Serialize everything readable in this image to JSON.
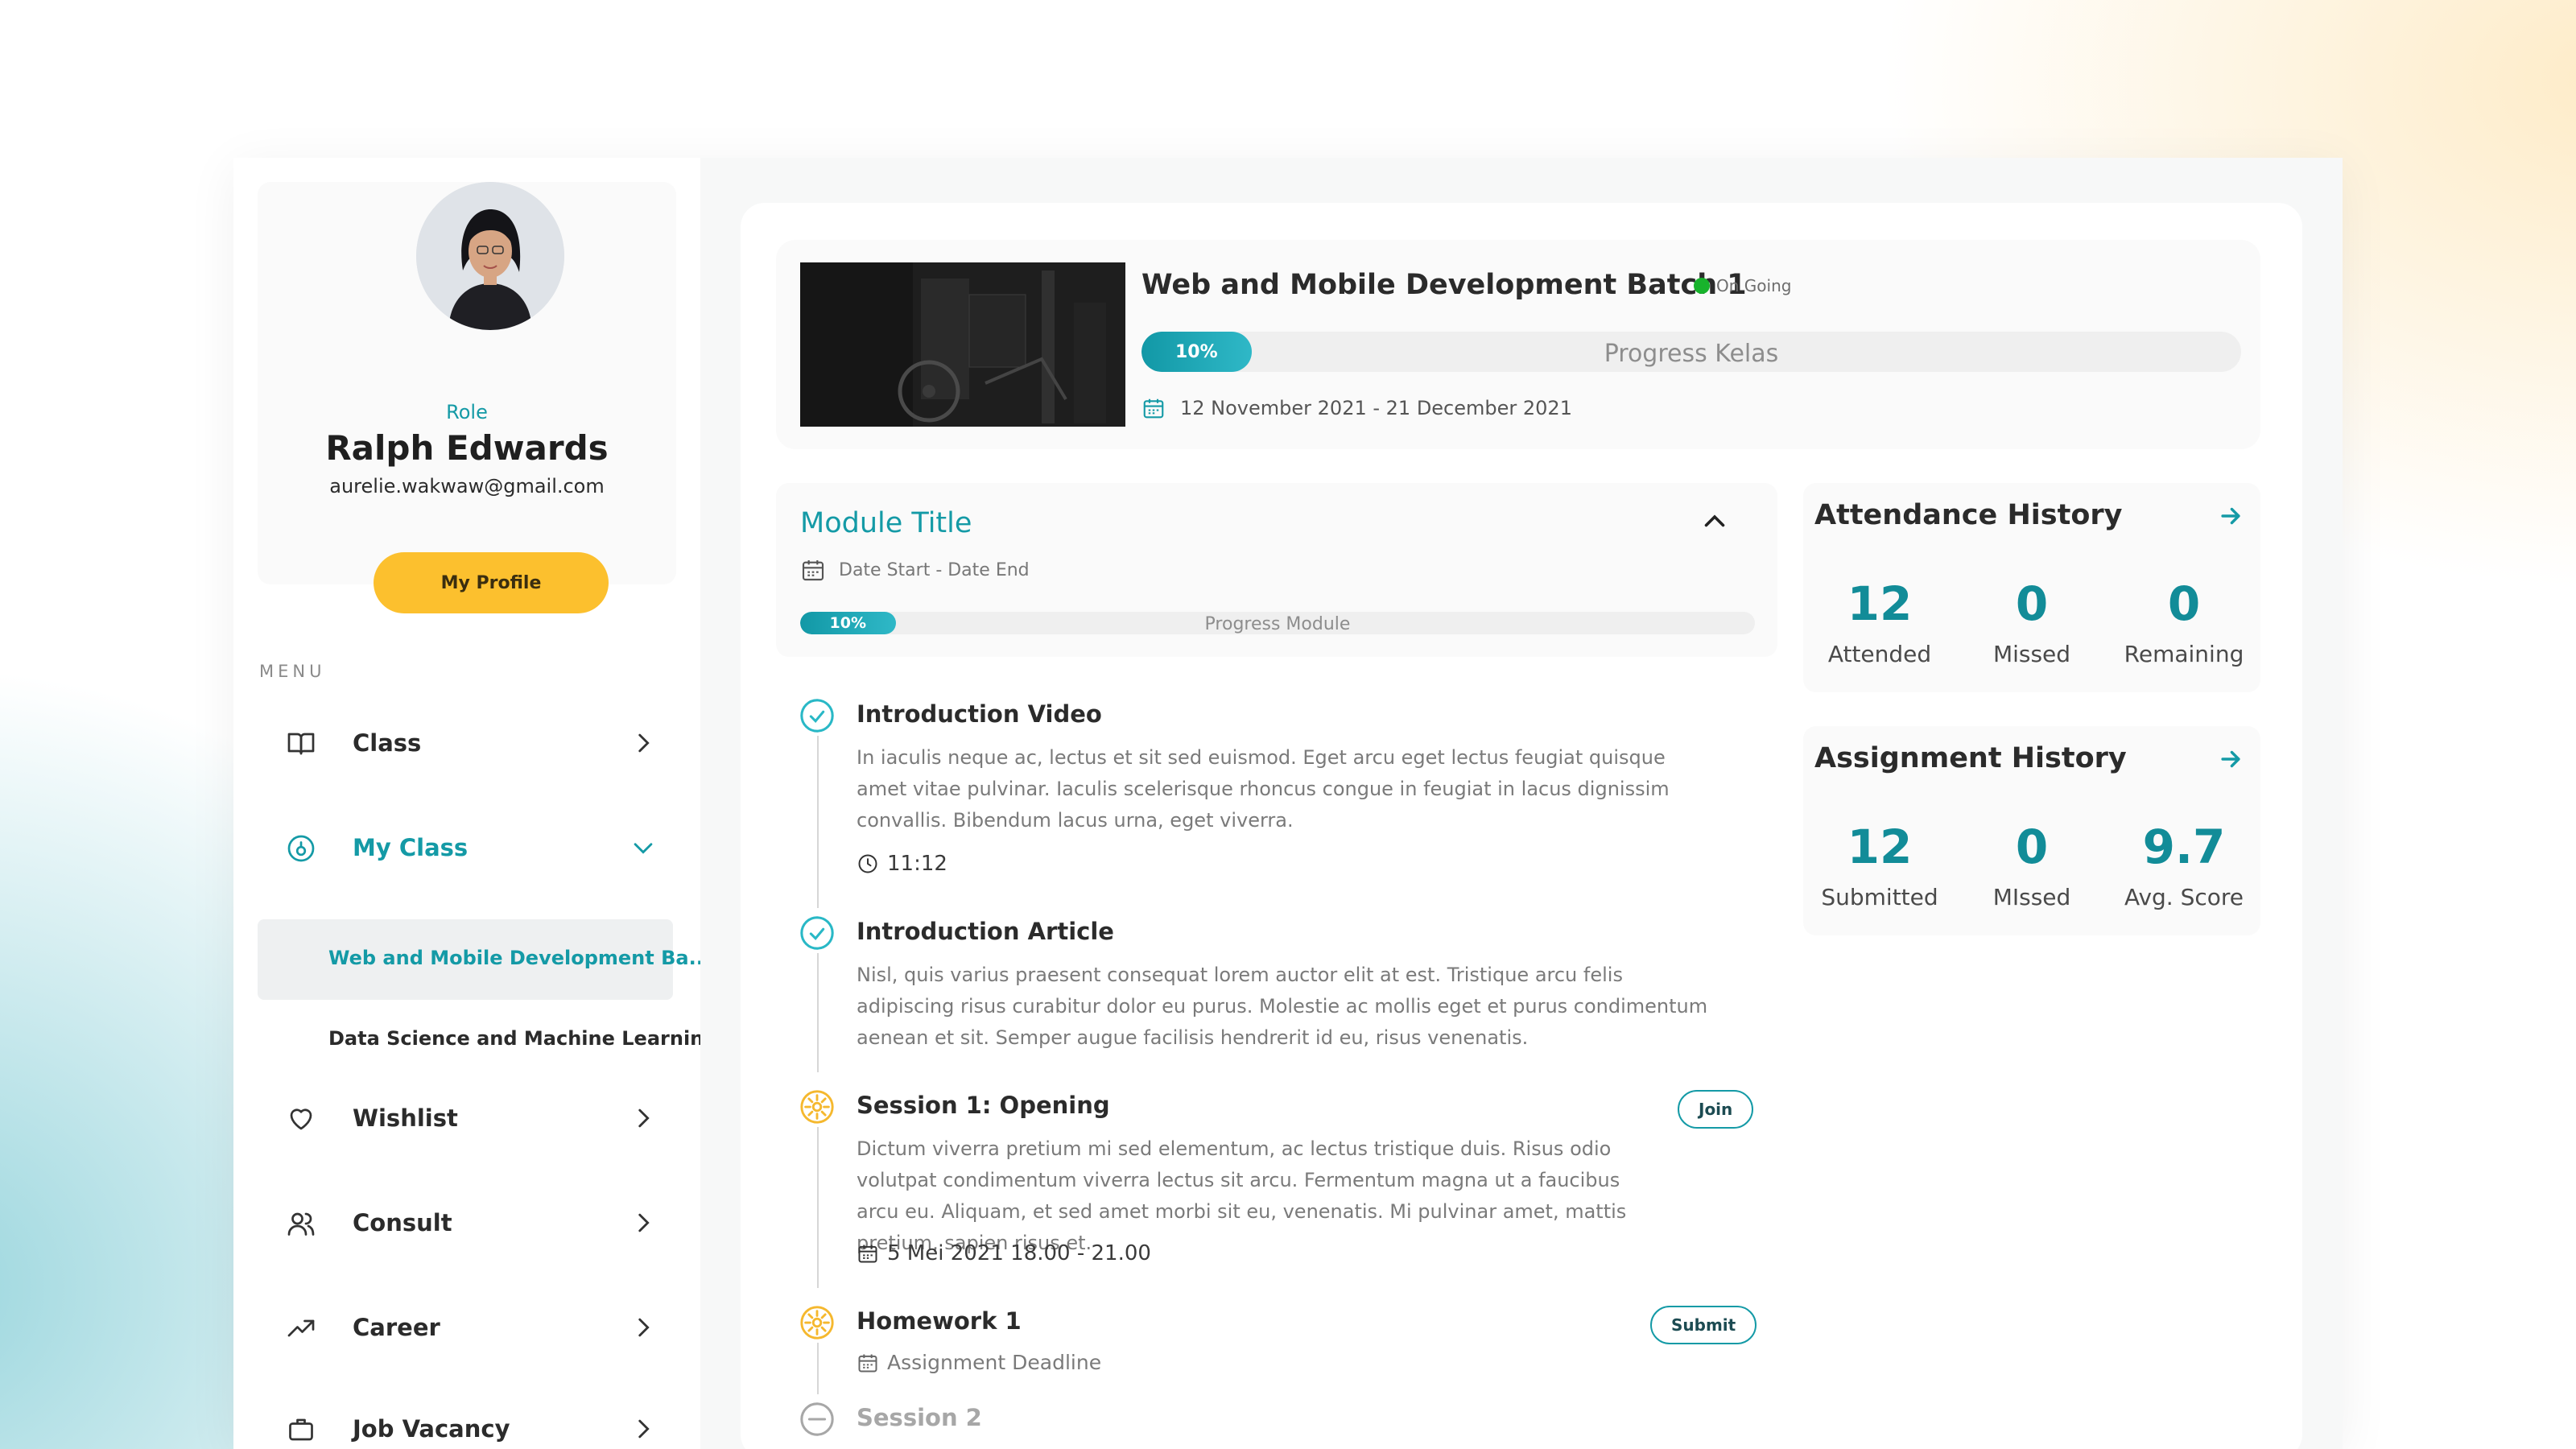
{
  "profile": {
    "role": "Role",
    "name": "Ralph Edwards",
    "email": "aurelie.wakwaw@gmail.com",
    "button_label": "My Profile"
  },
  "menu": {
    "label": "MENU",
    "items": [
      {
        "label": "Class",
        "icon": "book-open-icon"
      },
      {
        "label": "My Class",
        "icon": "class-target-icon"
      },
      {
        "label": "Wishlist",
        "icon": "heart-icon"
      },
      {
        "label": "Consult",
        "icon": "users-icon"
      },
      {
        "label": "Career",
        "icon": "trending-up-icon"
      },
      {
        "label": "Job Vacancy",
        "icon": "briefcase-icon"
      }
    ],
    "sub_items": [
      {
        "label": "Web and Mobile Development  Ba..."
      },
      {
        "label": "Data Science and Machine Learning"
      }
    ]
  },
  "class_header": {
    "title": "Web and Mobile Development Batch 1",
    "status": "On Going",
    "progress_label": "10%",
    "progress_value": 0.1,
    "progress_text": "Progress Kelas",
    "date_range": "12 November 2021 - 21 December 2021"
  },
  "module": {
    "title": "Module Title",
    "dates": "Date Start - Date End",
    "progress_label": "10%",
    "progress_value": 0.1,
    "progress_text": "Progress Module",
    "items": [
      {
        "title": "Introduction Video",
        "desc": "In iaculis neque ac, lectus et sit sed euismod. Eget arcu eget lectus feugiat quisque amet vitae pulvinar. Iaculis scelerisque rhoncus congue in feugiat in lacus dignissim convallis. Bibendum lacus urna, eget viverra.",
        "meta": "11:12",
        "status": "done"
      },
      {
        "title": "Introduction Article",
        "desc": "Nisl, quis varius praesent consequat lorem auctor elit at est. Tristique arcu felis adipiscing risus curabitur dolor eu purus. Molestie ac mollis eget et purus condimentum aenean et sit. Semper augue facilisis hendrerit id eu, risus venenatis.",
        "status": "done"
      },
      {
        "title": "Session 1: Opening",
        "desc": "Dictum viverra pretium mi sed elementum, ac lectus tristique duis. Risus odio volutpat condimentum viverra lectus sit arcu. Fermentum magna ut a faucibus arcu eu. Aliquam, et sed amet morbi sit eu, venenatis. Mi pulvinar amet, mattis pretium, sapien risus et.",
        "meta": "5 Mei 2021 18.00 - 21.00",
        "button": "Join",
        "status": "in-progress"
      },
      {
        "title": "Homework 1",
        "meta": "Assignment Deadline",
        "button": "Submit",
        "status": "in-progress"
      },
      {
        "title": "Session 2",
        "status": "locked"
      }
    ]
  },
  "attendance": {
    "title": "Attendance History",
    "stats": [
      {
        "value": "12",
        "label": "Attended"
      },
      {
        "value": "0",
        "label": "Missed"
      },
      {
        "value": "0",
        "label": "Remaining"
      }
    ]
  },
  "assignment": {
    "title": "Assignment History",
    "stats": [
      {
        "value": "12",
        "label": "Submitted"
      },
      {
        "value": "0",
        "label": "MIssed"
      },
      {
        "value": "9.7",
        "label": "Avg. Score"
      }
    ]
  },
  "colors": {
    "accent": "#149aa6",
    "button_yellow": "#fcc02e",
    "status_green": "#18b32c",
    "pending_yellow": "#f5b82e"
  }
}
